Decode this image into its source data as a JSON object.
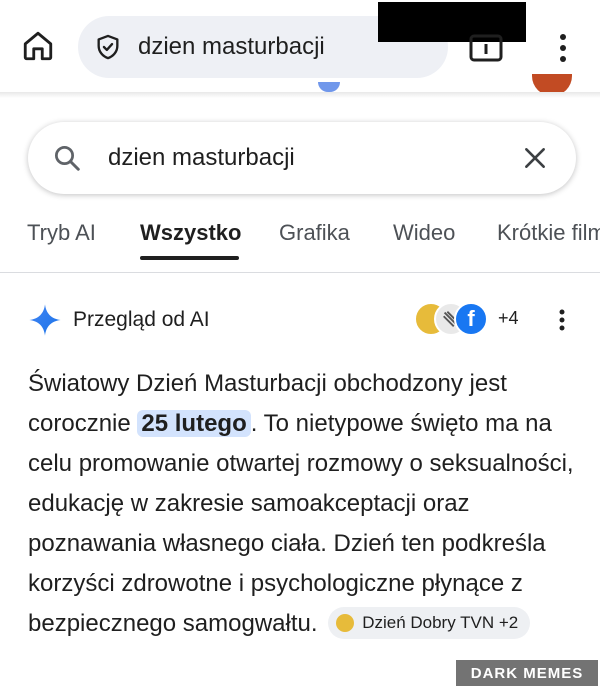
{
  "browser": {
    "url": "dzien masturbacji",
    "icons": {
      "home": "home-icon",
      "security": "shield-check-icon",
      "tabs": "tab-switcher-icon",
      "menu": "more-vert-icon"
    }
  },
  "search": {
    "query": "dzien masturbacji",
    "icons": {
      "search": "search-icon",
      "clear": "close-icon"
    }
  },
  "tabs": [
    {
      "label": "Tryb AI",
      "active": false
    },
    {
      "label": "Wszystko",
      "active": true
    },
    {
      "label": "Grafika",
      "active": false
    },
    {
      "label": "Wideo",
      "active": false
    },
    {
      "label": "Krótkie filmy",
      "active": false
    }
  ],
  "ai_overview": {
    "title": "Przegląd od AI",
    "sources_more": "+4",
    "source_icons": [
      "dzien-dobry-tvn-logo",
      "source-logo",
      "facebook-icon"
    ],
    "body": {
      "part1": "Światowy Dzień Masturbacji obchodzony jest corocznie ",
      "highlight": "25 lutego",
      "part2": ". To nietypowe święto ma na celu promowanie otwartej rozmowy o seksualności, edukację w zakresie samoakceptacji oraz poznawania własnego ciała. Dzień ten podkreśla korzyści zdrowotne i psychologiczne płynące z bezpiecznego samogwałtu.",
      "citation": "Dzień Dobry TVN +2"
    }
  },
  "colors": {
    "accent_blue": "#1a73e8",
    "highlight_bg": "#d3e3fd",
    "urlbar_bg": "#eef0f5"
  },
  "watermark": "DARK MEMES"
}
